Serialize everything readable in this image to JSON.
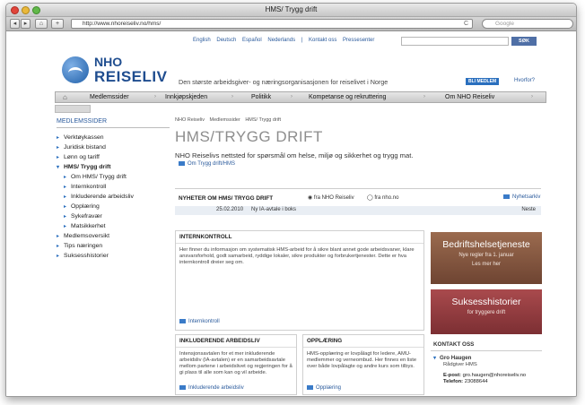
{
  "window": {
    "title": "HMS/ Trygg drift"
  },
  "toolbar": {
    "back": "◂",
    "forward": "▸",
    "home": "⌂",
    "add": "+",
    "url": "http://www.nhoreiseliv.no/hms/",
    "reload": "C",
    "search_placeholder": "Google"
  },
  "site": {
    "top_links": [
      "English",
      "Deutsch",
      "Español",
      "Nederlands",
      "|",
      "Kontakt oss",
      "Pressesenter"
    ],
    "search_button": "SØK",
    "logo_nho": "NHO",
    "logo_reiseliv": "REISELIV",
    "tagline": "Den største arbeidsgiver- og næringsorganisasjonen for reiselivet i Norge",
    "member_button": "BLI MEDLEM",
    "why_link": "Hvorfor?"
  },
  "nav": {
    "items": [
      "Medlemssider",
      "Innkjøpskjeden",
      "Politikk",
      "Kompetanse og rekruttering",
      "Om NHO Reiseliv"
    ]
  },
  "breadcrumb": [
    "NHO Reiseliv",
    "Medlemssider",
    "HMS/ Trygg drift"
  ],
  "sidebar": {
    "title": "MEDLEMSSIDER",
    "items": [
      {
        "label": "Verktøykassen",
        "level": 0
      },
      {
        "label": "Juridisk bistand",
        "level": 0
      },
      {
        "label": "Lønn og tariff",
        "level": 0
      },
      {
        "label": "HMS/ Trygg drift",
        "level": 0,
        "open": true,
        "bold": true
      },
      {
        "label": "Om HMS/ Trygg drift",
        "level": 1
      },
      {
        "label": "Internkontroll",
        "level": 1
      },
      {
        "label": "Inkluderende arbeidsliv",
        "level": 1
      },
      {
        "label": "Opplæring",
        "level": 1
      },
      {
        "label": "Sykefravær",
        "level": 1
      },
      {
        "label": "Matsikkerhet",
        "level": 1
      },
      {
        "label": "Medlemsoversikt",
        "level": 0
      },
      {
        "label": "Tips næringen",
        "level": 0
      },
      {
        "label": "Suksesshistorier",
        "level": 0
      }
    ]
  },
  "main": {
    "title": "HMS/TRYGG DRIFT",
    "intro": "NHO Reiselivs nettsted for spørsmål om helse, miljø og sikkerhet og trygg mat.",
    "intro_link": "Om Trygg drift/HMS"
  },
  "news": {
    "heading": "NYHETER OM HMS/ TRYGG DRIFT",
    "radio1": "fra NHO Reiseliv",
    "radio2": "fra nho.no",
    "archive": "Nyhetsarkiv",
    "date": "25.02.2010",
    "headline": "Ny IA-avtale i boks",
    "next": "Neste"
  },
  "panels": {
    "internkontroll": {
      "heading": "INTERNKONTROLL",
      "body": "Her finner du informasjon om systematisk HMS-arbeid for å sikre blant annet gode arbeidsvaner, klare ansvarsforhold, godt samarbeid, ryddige lokaler, sikre produkter og forbrukertjenester. Dette er hva internkontroll dreier seg om.",
      "link": "Internkontroll"
    },
    "ia": {
      "heading": "INKLUDERENDE ARBEIDSLIV",
      "body": "Intensjonsavtalen for et mer inkluderende arbeidsliv (IA-avtalen) er en samarbeidsavtale mellom partene i arbeidslivet og regjeringen for å gi plass til alle som kan og vil arbeide.",
      "link": "Inkluderende arbeidsliv"
    },
    "opplaering": {
      "heading": "OPPLÆRING",
      "body": "HMS-opplæring er lovpålagt for ledere, AMU-medlemmer og verneombud. Her finnes en liste over både lovpålagte og andre kurs som tilbys.",
      "link": "Opplæring"
    }
  },
  "ads": {
    "ad1_title": "Bedriftshelsetjeneste",
    "ad1_sub": "Nye regler fra 1. januar",
    "ad1_sub2": "Les mer her",
    "ad2_title": "Suksesshistorier",
    "ad2_sub": "for tryggere drift"
  },
  "contact": {
    "heading": "KONTAKT OSS",
    "name": "Gro Haugen",
    "role": "Rådgiver HMS",
    "email_label": "E-post:",
    "email": "gro.haugen@nhoreiseliv.no",
    "phone_label": "Telefon:",
    "phone": "23088644"
  },
  "colors": {
    "brand_blue": "#1f4d8f",
    "link_blue": "#2a5a9c",
    "ad1": "#8a5b43",
    "ad2": "#9a3f43"
  }
}
